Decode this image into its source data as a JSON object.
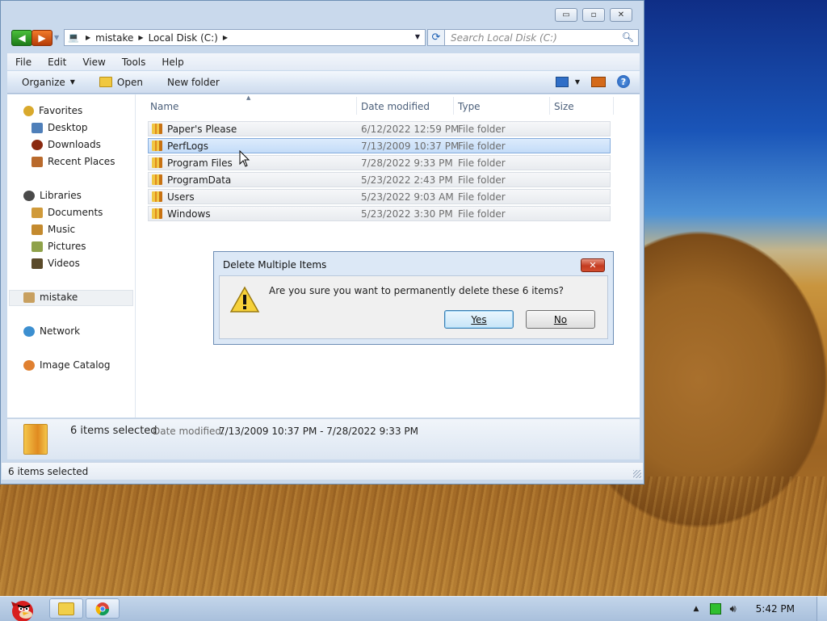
{
  "window": {
    "controls": {
      "minimize": "▭",
      "maximize": "▫",
      "close": "✕"
    }
  },
  "address": {
    "crumbs": [
      "mistake",
      "Local Disk (C:)"
    ],
    "search_placeholder": "Search Local Disk (C:)"
  },
  "menu": [
    "File",
    "Edit",
    "View",
    "Tools",
    "Help"
  ],
  "toolbar": {
    "organize": "Organize",
    "open": "Open",
    "new_folder": "New folder"
  },
  "nav": {
    "favorites": "Favorites",
    "desktop": "Desktop",
    "downloads": "Downloads",
    "recent": "Recent Places",
    "libraries": "Libraries",
    "documents": "Documents",
    "music": "Music",
    "pictures": "Pictures",
    "videos": "Videos",
    "user": "mistake",
    "network": "Network",
    "image_catalog": "Image Catalog"
  },
  "columns": {
    "name": "Name",
    "date": "Date modified",
    "type": "Type",
    "size": "Size"
  },
  "files": [
    {
      "name": "Paper's Please",
      "date": "6/12/2022 12:59 PM",
      "type": "File folder"
    },
    {
      "name": "PerfLogs",
      "date": "7/13/2009 10:37 PM",
      "type": "File folder"
    },
    {
      "name": "Program Files",
      "date": "7/28/2022 9:33 PM",
      "type": "File folder"
    },
    {
      "name": "ProgramData",
      "date": "5/23/2022 2:43 PM",
      "type": "File folder"
    },
    {
      "name": "Users",
      "date": "5/23/2022 9:03 AM",
      "type": "File folder"
    },
    {
      "name": "Windows",
      "date": "5/23/2022 3:30 PM",
      "type": "File folder"
    }
  ],
  "details": {
    "count": "6 items selected",
    "date_label": "Date modified:",
    "date_value": "7/13/2009 10:37 PM - 7/28/2022 9:33 PM"
  },
  "status": "6 items selected",
  "dialog": {
    "title": "Delete Multiple Items",
    "message": "Are you sure you want to permanently delete these 6 items?",
    "yes_label": "Yes",
    "no_label": "No",
    "close_label": "✕"
  },
  "taskbar": {
    "clock": "5:42 PM"
  }
}
